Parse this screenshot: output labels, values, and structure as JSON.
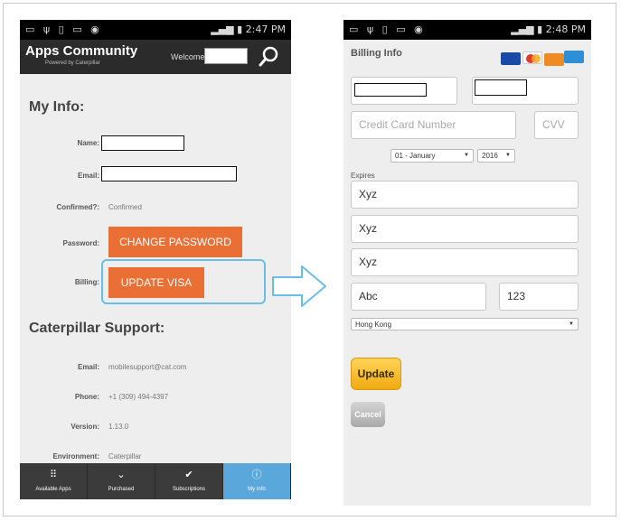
{
  "left_phone": {
    "status": {
      "icons": "▭ ψ ▯ ▭ ◉",
      "time": "2:47 PM"
    },
    "header": {
      "title": "Apps Community",
      "subtitle": "Powered by Caterpillar",
      "welcome": "Welcome:"
    },
    "my_info": {
      "heading": "My Info:",
      "name_label": "Name:",
      "email_label": "Email:",
      "confirmed_label": "Confirmed?:",
      "confirmed_value": "Confirmed",
      "password_label": "Password:",
      "change_password_button": "CHANGE PASSWORD",
      "billing_label": "Billing:",
      "update_visa_button": "UPDATE VISA"
    },
    "support": {
      "heading": "Caterpillar Support:",
      "email_label": "Email:",
      "email_value": "mobilesupport@cat.com",
      "phone_label": "Phone:",
      "phone_value": "+1 (309) 494-4397",
      "version_label": "Version:",
      "version_value": "1.13.0",
      "environment_label": "Environment:",
      "environment_value": "Caterpillar"
    },
    "tabs": [
      {
        "label": "Available Apps",
        "icon": "grid-icon"
      },
      {
        "label": "Purchased",
        "icon": "chevron-down-icon"
      },
      {
        "label": "Subscriptions",
        "icon": "check-icon"
      },
      {
        "label": "My Info",
        "icon": "info-icon",
        "active": true
      }
    ]
  },
  "right_phone": {
    "status": {
      "icons": "▭ ψ ▯ ▭ ◉",
      "time": "2:48 PM"
    },
    "title": "Billing Info",
    "card_brands": [
      {
        "name": "visa-card-icon",
        "color": "#1a4aa8"
      },
      {
        "name": "mastercard-icon",
        "color": "#e23b2e"
      },
      {
        "name": "discover-card-icon",
        "color": "#f08a24"
      },
      {
        "name": "amex-card-icon",
        "color": "#2d8fd5"
      }
    ],
    "card_number_placeholder": "Credit Card Number",
    "cvv_placeholder": "CVV",
    "expires_label": "Expires",
    "month_selected": "01 - January",
    "year_selected": "2016",
    "address1": "Xyz",
    "address2": "Xyz",
    "address3": "Xyz",
    "city": "Abc",
    "zip": "123",
    "country_selected": "Hong Kong",
    "update_button": "Update",
    "cancel_button": "Cancel"
  },
  "colors": {
    "accent_orange": "#ea6f35",
    "highlight_blue": "#67bfe5",
    "active_tab": "#5aa7dc",
    "update_yellow": "#f7c230"
  }
}
